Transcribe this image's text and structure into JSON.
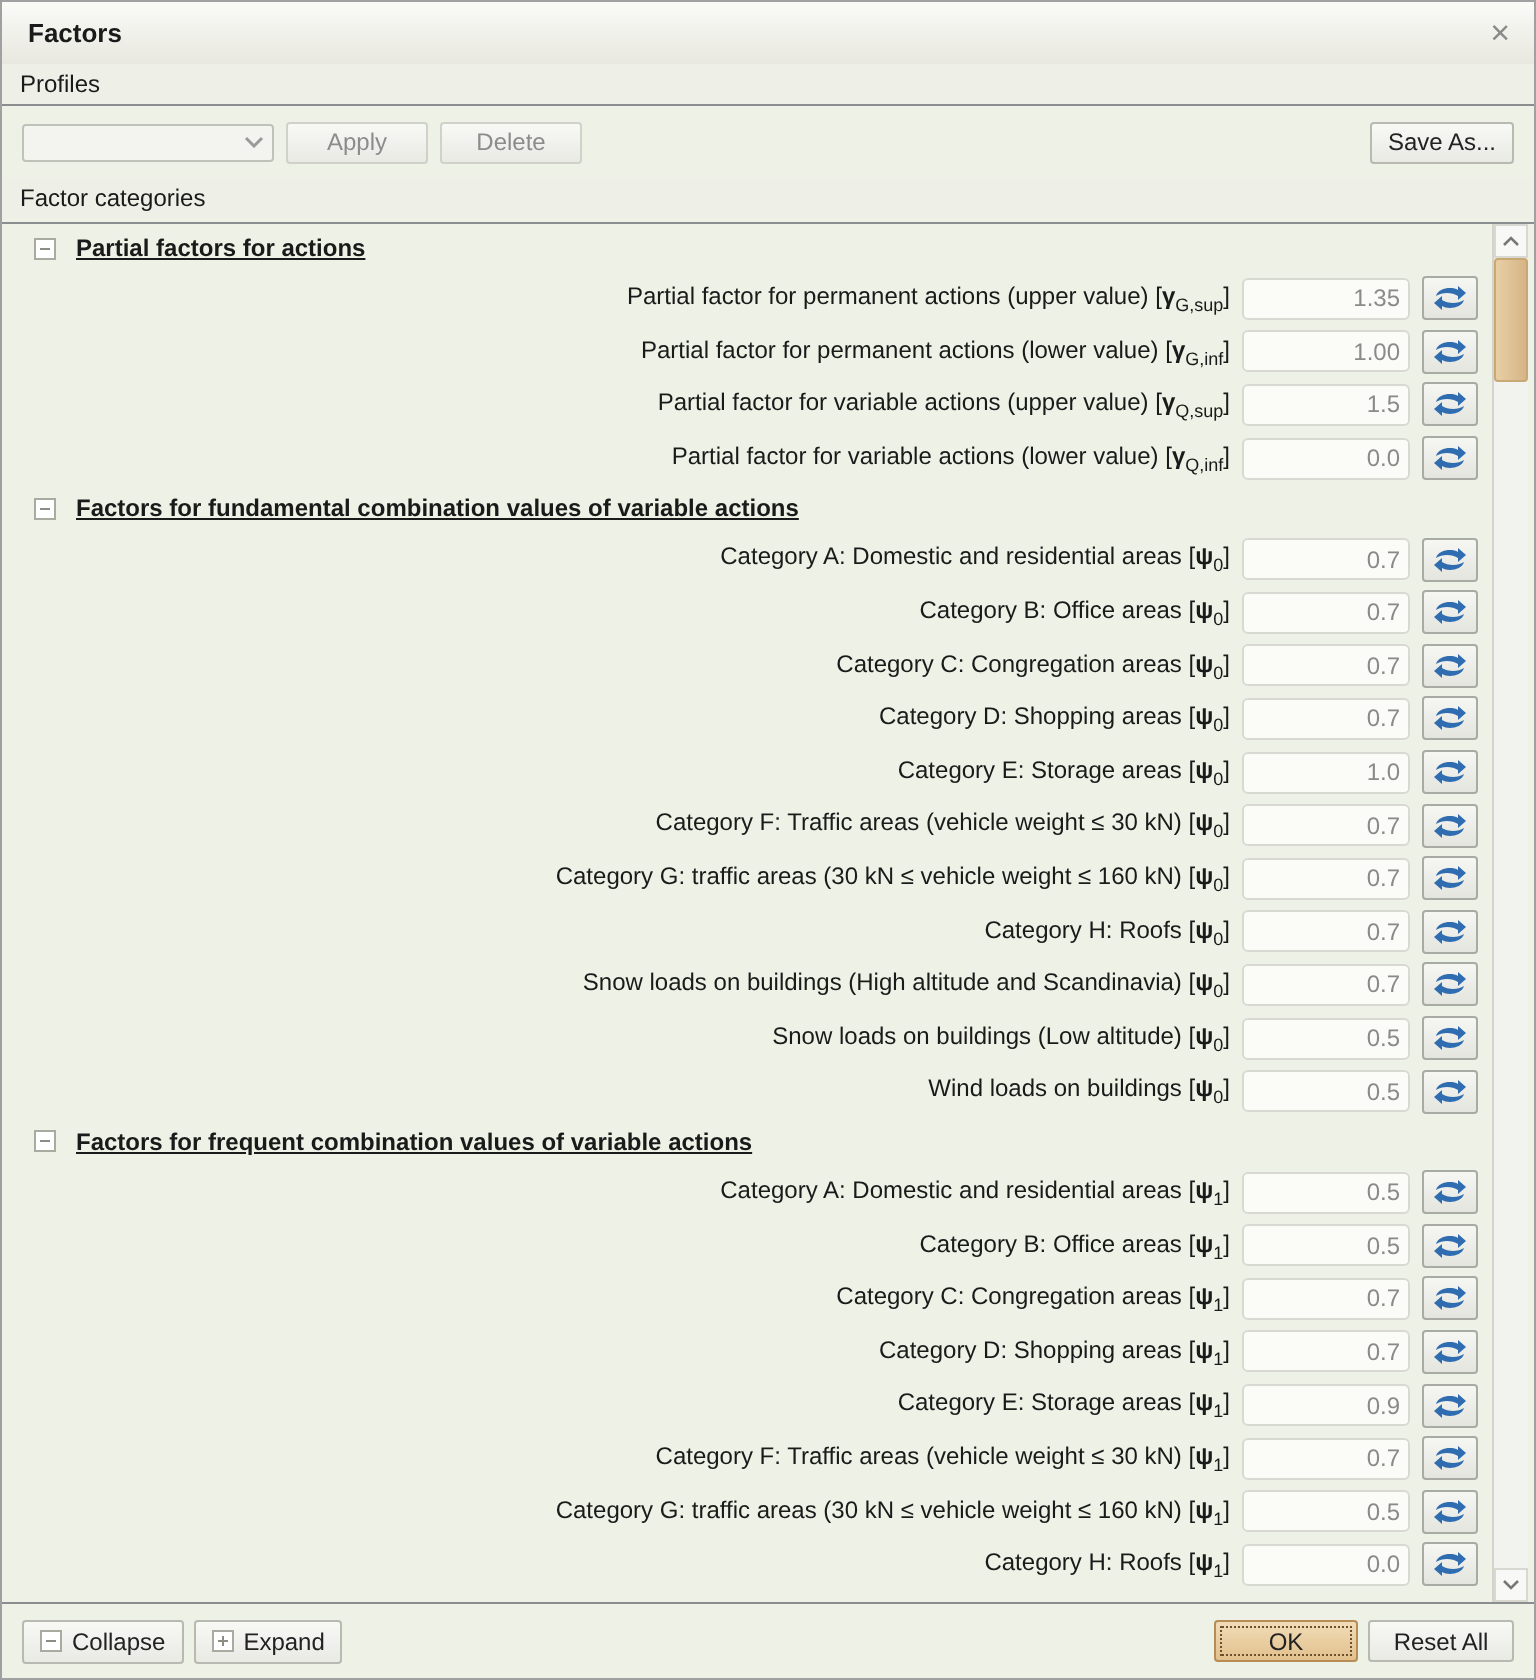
{
  "window": {
    "title": "Factors",
    "close": "×"
  },
  "profiles": {
    "title": "Profiles",
    "buttons": [
      {
        "label": "Apply",
        "disabled": true
      },
      {
        "label": "Delete",
        "disabled": true
      }
    ],
    "save_button": "Save As..."
  },
  "categories_title": "Factor categories",
  "sections": [
    {
      "title": "Partial factors for actions",
      "expanded": true,
      "rows": [
        {
          "label": "Partial factor for permanent actions (upper value) [**γ**$_{G,sup}$]",
          "value": "1.35"
        },
        {
          "label": "Partial factor for permanent actions (lower value) [**γ**$_{G,inf}$]",
          "value": "1.00"
        },
        {
          "label": "Partial factor for variable actions (upper value) [**γ**$_{Q,sup}$]",
          "value": "1.5"
        },
        {
          "label": "Partial factor for variable actions (lower value) [**γ**$_{Q,inf}$]",
          "value": "0.0"
        }
      ]
    },
    {
      "title": "Factors for fundamental combination values of variable actions",
      "expanded": true,
      "rows": [
        {
          "label": "Category A: Domestic and residential areas [**ψ**$_{0}$]",
          "value": "0.7"
        },
        {
          "label": "Category B: Office areas [**ψ**$_{0}$]",
          "value": "0.7"
        },
        {
          "label": "Category C: Congregation areas [**ψ**$_{0}$]",
          "value": "0.7"
        },
        {
          "label": "Category D: Shopping areas [**ψ**$_{0}$]",
          "value": "0.7"
        },
        {
          "label": "Category E: Storage areas [**ψ**$_{0}$]",
          "value": "1.0"
        },
        {
          "label": "Category F: Traffic areas (vehicle weight ≤ 30 kN) [**ψ**$_{0}$]",
          "value": "0.7"
        },
        {
          "label": "Category G: traffic areas (30 kN ≤ vehicle weight ≤ 160 kN) [**ψ**$_{0}$]",
          "value": "0.7"
        },
        {
          "label": "Category H: Roofs [**ψ**$_{0}$]",
          "value": "0.7"
        },
        {
          "label": "Snow loads on buildings (High altitude and Scandinavia) [**ψ**$_{0}$]",
          "value": "0.7"
        },
        {
          "label": "Snow loads on buildings (Low altitude) [**ψ**$_{0}$]",
          "value": "0.5"
        },
        {
          "label": "Wind loads on buildings [**ψ**$_{0}$]",
          "value": "0.5"
        }
      ]
    },
    {
      "title": "Factors for frequent combination values of variable actions",
      "expanded": true,
      "rows": [
        {
          "label": "Category A: Domestic and residential areas [**ψ**$_{1}$]",
          "value": "0.5"
        },
        {
          "label": "Category B: Office areas [**ψ**$_{1}$]",
          "value": "0.5"
        },
        {
          "label": "Category C: Congregation areas [**ψ**$_{1}$]",
          "value": "0.7"
        },
        {
          "label": "Category D: Shopping areas [**ψ**$_{1}$]",
          "value": "0.7"
        },
        {
          "label": "Category E: Storage areas [**ψ**$_{1}$]",
          "value": "0.9"
        },
        {
          "label": "Category F: Traffic areas (vehicle weight ≤ 30 kN) [**ψ**$_{1}$]",
          "value": "0.7"
        },
        {
          "label": "Category G: traffic areas (30 kN ≤ vehicle weight ≤ 160 kN) [**ψ**$_{1}$]",
          "value": "0.5"
        },
        {
          "label": "Category H: Roofs [**ψ**$_{1}$]",
          "value": "0.0"
        }
      ]
    }
  ],
  "footer": {
    "collapse": "Collapse",
    "expand": "Expand",
    "ok": "OK",
    "reset": "Reset All"
  }
}
